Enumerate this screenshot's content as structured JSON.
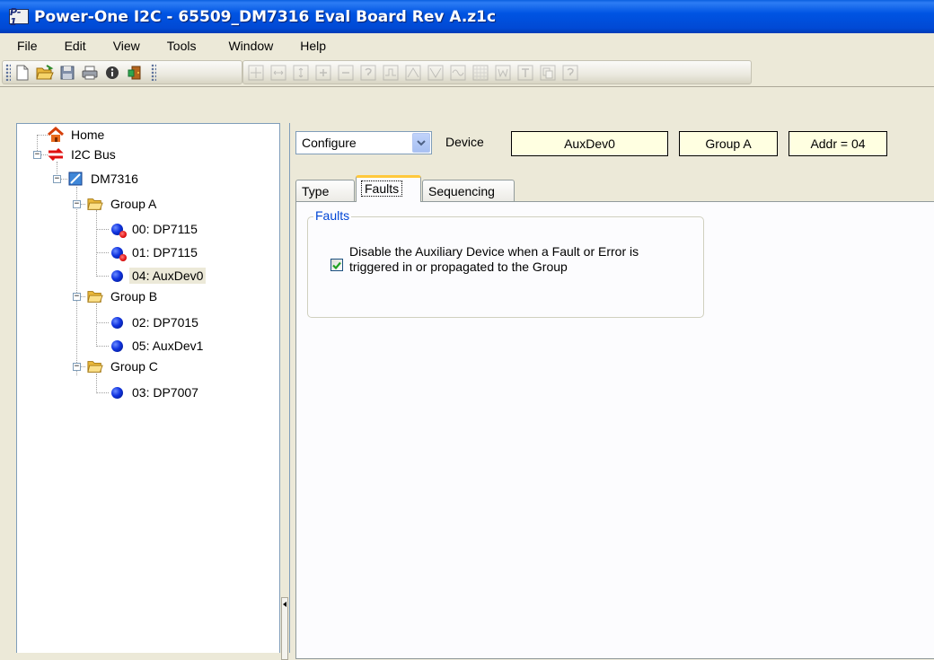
{
  "window": {
    "title": "Power-One I2C - 65509_DM7316 Eval Board Rev A.z1c",
    "logo_text": "P-1"
  },
  "menu": [
    "File",
    "Edit",
    "View",
    "Tools",
    "Window",
    "Help"
  ],
  "toolbar": {
    "file_icons": [
      "new-document-icon",
      "open-folder-icon",
      "save-icon",
      "print-icon",
      "info-icon",
      "exit-door-icon"
    ],
    "device_icons": [
      "fit-icon",
      "width-icon",
      "height-icon",
      "zoom-in-icon",
      "zoom-out-icon",
      "help-query-icon",
      "waveform-icon",
      "rise-icon",
      "fall-icon",
      "sine-icon",
      "grid-icon",
      "w-icon",
      "text-icon",
      "copy-icon",
      "help-icon"
    ]
  },
  "tree": {
    "home": "Home",
    "bus": "I2C Bus",
    "board": "DM7316",
    "groups": [
      {
        "label": "Group A",
        "devices": [
          {
            "label": "00: DP7115",
            "fault": true
          },
          {
            "label": "01: DP7115",
            "fault": true
          },
          {
            "label": "04: AuxDev0",
            "fault": false,
            "selected": true
          }
        ]
      },
      {
        "label": "Group B",
        "devices": [
          {
            "label": "02: DP7015",
            "fault": false
          },
          {
            "label": "05: AuxDev1",
            "fault": false
          }
        ]
      },
      {
        "label": "Group C",
        "devices": [
          {
            "label": "03: DP7007",
            "fault": false
          }
        ]
      }
    ]
  },
  "config": {
    "mode": "Configure",
    "device_label": "Device",
    "device_value": "AuxDev0",
    "group_value": "Group A",
    "addr_value": "Addr = 04"
  },
  "tabs": [
    "Type",
    "Faults",
    "Sequencing"
  ],
  "active_tab": "Faults",
  "faults": {
    "group_title": "Faults",
    "checkbox_checked": true,
    "checkbox_label": "Disable the Auxiliary Device when a Fault or Error is triggered in or propagated to the Group"
  },
  "colors": {
    "titlebar": "#0054e3",
    "legend": "#0046d5",
    "infobox_bg": "#ffffe1",
    "tab_highlight": "#ffc83c"
  }
}
